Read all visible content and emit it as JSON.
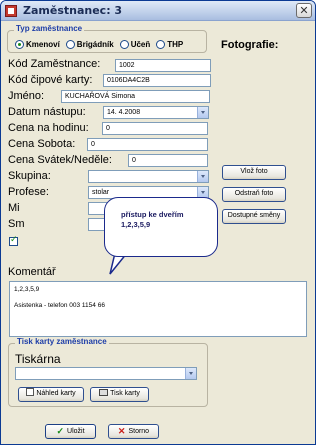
{
  "window": {
    "title": "Zaměstnanec: 3",
    "close_label": "✕"
  },
  "type_group": {
    "legend": "Typ zaměstnance",
    "options": [
      "Kmenoví",
      "Brigádník",
      "Učeň",
      "THP"
    ],
    "selected": "Kmenoví"
  },
  "form": {
    "kod_zamestnance": {
      "label": "Kód Zaměstnance:",
      "value": "1002"
    },
    "kod_cipove_karty": {
      "label": "Kód čipové karty:",
      "value": "0106DA4C2B"
    },
    "jmeno": {
      "label": "Jméno:",
      "value": "KUCHAŘOVÁ Simona"
    },
    "datum_nastupu": {
      "label": "Datum nástupu:",
      "value": "14. 4.2008"
    },
    "cena_na_hodinu": {
      "label": "Cena na hodinu:",
      "value": "0"
    },
    "cena_sobota": {
      "label": "Cena Sobota:",
      "value": "0"
    },
    "cena_svatek": {
      "label": "Cena Svátek/Neděle:",
      "value": "0"
    },
    "skupina": {
      "label": "Skupina:",
      "value": ""
    },
    "profese": {
      "label": "Profese:",
      "value": "stolar"
    },
    "mi_label": "Mi",
    "sm_label": "Sm"
  },
  "photo": {
    "label": "Fotografie:",
    "buttons": [
      "Vlož foto",
      "Odstraň foto",
      "Dostupné směny"
    ]
  },
  "tooltip": {
    "line1": "přístup ke dveřím",
    "line2": "1,2,3,5,9"
  },
  "comment": {
    "label": "Komentář",
    "lines": [
      "1,2,3,5,9",
      "Asistenka - telefon 003 1154 66"
    ]
  },
  "print_group": {
    "legend": "Tisk karty zaměstnance",
    "printer_label": "Tiskárna",
    "printer_value": "",
    "preview_button": "Náhled karty",
    "print_button": "Tisk karty"
  },
  "footer": {
    "save_button": "Uložit",
    "cancel_button": "Storno"
  },
  "colors": {
    "legend_blue": "#1e3ea8",
    "tooltip_border": "#1b2a8c",
    "save_check_green": "#1a8a1a",
    "cancel_x_red": "#c8201b"
  }
}
